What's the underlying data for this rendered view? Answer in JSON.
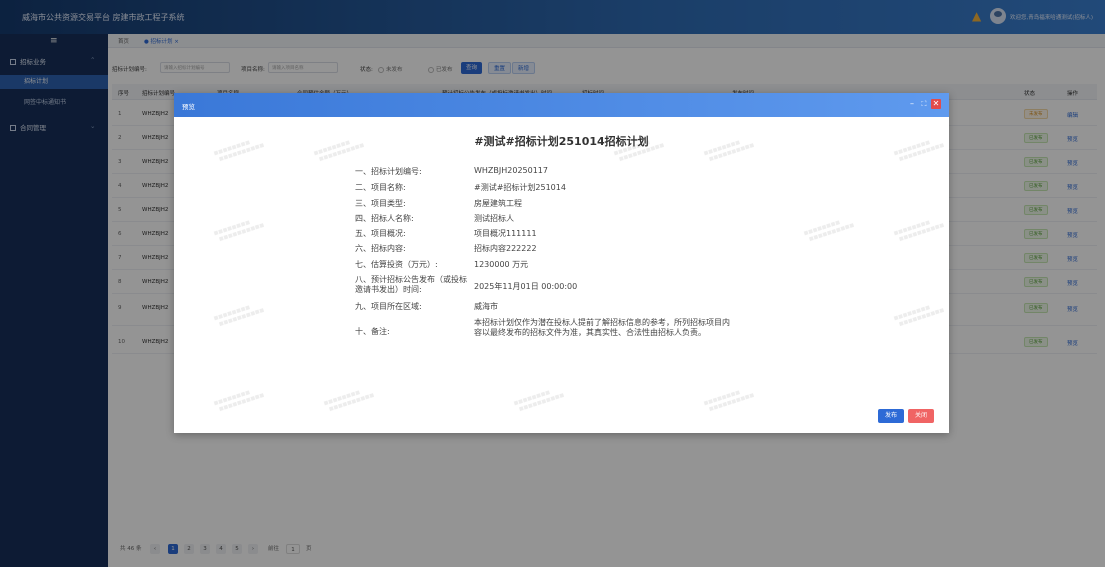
{
  "header": {
    "title": "威海市公共资源交易平台  房建市政工程子系统",
    "welcome": "欢迎您,青岛福来哈通测试(招标人)"
  },
  "sidebar": {
    "toggle": "≡",
    "groups": [
      {
        "label": "招标业务"
      },
      {
        "label": "合同管理"
      }
    ],
    "items": [
      {
        "label": "招标计划"
      },
      {
        "label": "网签中标通知书"
      }
    ]
  },
  "tabs": {
    "home": "首页",
    "current": "● 招标计划 ×"
  },
  "filter": {
    "plan_no_label": "招标计划编号:",
    "plan_no_placeholder": "请输入招标计划编号",
    "project_name_label": "项目名称:",
    "project_name_placeholder": "请输入项目名称",
    "status_label": "状态:",
    "status_unpublished": "未发布",
    "status_published": "已发布",
    "search_btn": "查询",
    "reset_btn": "重置",
    "add_btn": "新增"
  },
  "table": {
    "headers": [
      "序号",
      "招标计划编号",
      "项目名称",
      "合同预估金额（万元）",
      "预计招标公告发布（或投标邀请书发出）时间",
      "招标时间",
      "发布时间",
      "状态",
      "操作"
    ],
    "rows": [
      {
        "no": "1",
        "code": "WHZBJH2",
        "status": "未发布",
        "op": "编辑"
      },
      {
        "no": "2",
        "code": "WHZBJH2",
        "status": "已发布",
        "op": "预览"
      },
      {
        "no": "3",
        "code": "WHZBJH2",
        "status": "已发布",
        "op": "预览"
      },
      {
        "no": "4",
        "code": "WHZBJH2",
        "status": "已发布",
        "op": "预览"
      },
      {
        "no": "5",
        "code": "WHZBJH2",
        "status": "已发布",
        "op": "预览"
      },
      {
        "no": "6",
        "code": "WHZBJH2",
        "status": "已发布",
        "op": "预览"
      },
      {
        "no": "7",
        "code": "WHZBJH2",
        "status": "已发布",
        "op": "预览"
      },
      {
        "no": "8",
        "code": "WHZBJH2",
        "status": "已发布",
        "op": "预览"
      },
      {
        "no": "9",
        "code": "WHZBJH2",
        "status": "已发布",
        "op": "预览"
      },
      {
        "no": "10",
        "code": "WHZBJH2",
        "status": "已发布",
        "op": "预览"
      }
    ]
  },
  "pager": {
    "total": "共 46 条",
    "pages": [
      "1",
      "2",
      "3",
      "4",
      "5"
    ],
    "goto": "前往",
    "goto_value": "1",
    "page_unit": "页"
  },
  "modal": {
    "title": "预览",
    "doc_title": "#测试#招标计划251014招标计划",
    "fields": [
      {
        "label": "一、招标计划编号:",
        "value": "WHZBJH20250117"
      },
      {
        "label": "二、项目名称:",
        "value": "#测试#招标计划251014"
      },
      {
        "label": "三、项目类型:",
        "value": "房屋建筑工程"
      },
      {
        "label": "四、招标人名称:",
        "value": "测试招标人"
      },
      {
        "label": "五、项目概况:",
        "value": "项目概况111111"
      },
      {
        "label": "六、招标内容:",
        "value": "招标内容222222"
      },
      {
        "label": "七、估算投资（万元）:",
        "value": "1230000 万元"
      },
      {
        "label": "八、预计招标公告发布（或投标邀请书发出）时间:",
        "value": "2025年11月01日 00:00:00"
      },
      {
        "label": "九、项目所在区域:",
        "value": "威海市"
      },
      {
        "label": "十、备注:",
        "value": "本招标计划仅作为潜在投标人提前了解招标信息的参考，所列招标项目内容以最终发布的招标文件为准，其真实性、合法性由招标人负责。"
      }
    ],
    "publish_btn": "发布",
    "close_btn": "关闭"
  },
  "colors": {
    "accent": "#2d6ad6",
    "sidebar": "#17305a",
    "danger": "#f06464"
  }
}
